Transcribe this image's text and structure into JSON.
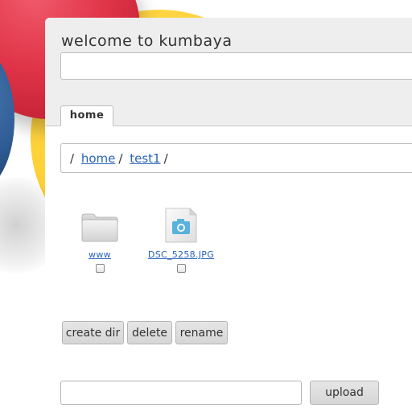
{
  "header": {
    "title": "welcome to kumbaya"
  },
  "tabs": [
    {
      "label": "home",
      "active": true
    }
  ],
  "breadcrumb": {
    "root": "/",
    "items": [
      {
        "label": "home"
      },
      {
        "label": "test1"
      }
    ],
    "trailing": "/"
  },
  "files": [
    {
      "name": "www",
      "type": "folder",
      "icon": "folder-icon",
      "checked": false
    },
    {
      "name": "DSC_5258.JPG",
      "type": "image",
      "icon": "camera-image-file-icon",
      "checked": false
    }
  ],
  "actions": {
    "create_dir": "create dir",
    "delete": "delete",
    "rename": "rename"
  },
  "upload": {
    "button_label": "upload",
    "file_value": ""
  },
  "colors": {
    "link": "#2a63b8",
    "header_bg": "#eeeeee",
    "button_bg": "#dcdcdc",
    "ball_red": "#e03448",
    "ball_yellow": "#ffd23a",
    "ball_blue": "#2d5a92"
  }
}
